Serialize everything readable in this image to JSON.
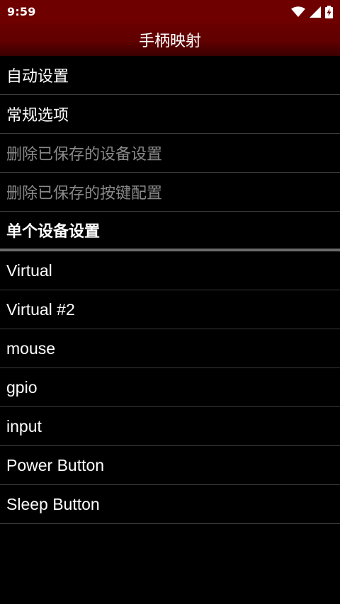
{
  "status_bar": {
    "time": "9:59",
    "icons": [
      "wifi-icon",
      "cell-signal-icon",
      "battery-charging-icon"
    ]
  },
  "app_bar": {
    "title": "手柄映射"
  },
  "menu": {
    "items": [
      {
        "label": "自动设置",
        "enabled": true
      },
      {
        "label": "常规选项",
        "enabled": true
      },
      {
        "label": "删除已保存的设备设置",
        "enabled": false
      },
      {
        "label": "删除已保存的按键配置",
        "enabled": false
      }
    ]
  },
  "section": {
    "header": "单个设备设置"
  },
  "devices": [
    {
      "label": "Virtual"
    },
    {
      "label": "Virtual #2"
    },
    {
      "label": "mouse"
    },
    {
      "label": "gpio"
    },
    {
      "label": "input"
    },
    {
      "label": "Power Button"
    },
    {
      "label": "Sleep Button"
    }
  ],
  "colors": {
    "app_bar": "#6e0000",
    "background": "#000000",
    "disabled_text": "#8a8a8a",
    "divider": "#3a3a3a"
  }
}
